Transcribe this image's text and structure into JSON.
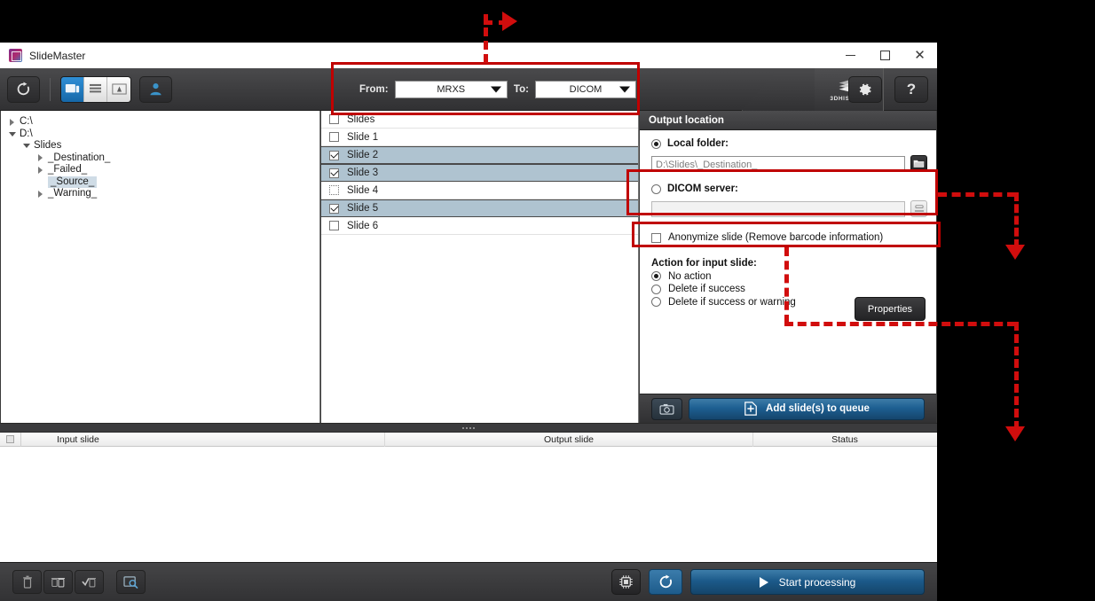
{
  "window": {
    "title": "SlideMaster",
    "logo_icon": "slidemaster-logo-icon",
    "minimize_label": "–",
    "maximize_label": "□",
    "close_label": "✕"
  },
  "toolbar": {
    "refresh_icon": "refresh-icon",
    "view_modes": [
      {
        "icon": "local-view-icon",
        "active": true
      },
      {
        "icon": "list-view-icon",
        "active": false
      },
      {
        "icon": "scanner-view-icon",
        "active": false
      }
    ],
    "user_icon": "user-icon",
    "from_label": "From:",
    "from_value": "MRXS",
    "to_label": "To:",
    "to_value": "DICOM",
    "brand_name": "3DHISTECH",
    "brand_icon": "stacked-slides-icon",
    "settings_icon": "gear-icon",
    "help_label": "?"
  },
  "tree": {
    "nodes": [
      {
        "label": "C:\\",
        "depth": 0,
        "expander": "collapsed",
        "selected": false
      },
      {
        "label": "D:\\",
        "depth": 0,
        "expander": "expanded",
        "selected": false
      },
      {
        "label": "Slides",
        "depth": 1,
        "expander": "expanded",
        "selected": false
      },
      {
        "label": "_Destination_",
        "depth": 2,
        "expander": "collapsed",
        "selected": false
      },
      {
        "label": "_Failed_",
        "depth": 2,
        "expander": "collapsed",
        "selected": false
      },
      {
        "label": "_Source_",
        "depth": 2,
        "expander": "none",
        "selected": true
      },
      {
        "label": "_Warning_",
        "depth": 2,
        "expander": "collapsed",
        "selected": false
      }
    ]
  },
  "slide_list": {
    "rows": [
      {
        "label": "Slides",
        "checked": false,
        "selected": false,
        "dotted": false
      },
      {
        "label": "Slide 1",
        "checked": false,
        "selected": false,
        "dotted": false
      },
      {
        "label": "Slide 2",
        "checked": true,
        "selected": true,
        "dotted": false
      },
      {
        "label": "Slide 3",
        "checked": true,
        "selected": true,
        "dotted": false
      },
      {
        "label": "Slide 4",
        "checked": false,
        "selected": false,
        "dotted": true
      },
      {
        "label": "Slide 5",
        "checked": true,
        "selected": true,
        "dotted": false
      },
      {
        "label": "Slide 6",
        "checked": false,
        "selected": false,
        "dotted": false
      }
    ]
  },
  "output_panel": {
    "header": "Output location",
    "local_folder_label": "Local folder:",
    "local_folder_selected": true,
    "local_folder_value": "D:\\Slides\\_Destination_",
    "browse_icon": "folder-icon",
    "dicom_server_label": "DICOM server:",
    "dicom_server_selected": false,
    "dicom_server_value": "",
    "dicom_browse_icon": "server-icon",
    "anonymize_label": "Anonymize slide (Remove barcode information)",
    "anonymize_checked": false,
    "action_title": "Action for input slide:",
    "actions": [
      {
        "label": "No action",
        "selected": true
      },
      {
        "label": "Delete if success",
        "selected": false
      },
      {
        "label": "Delete if success or warning",
        "selected": false
      }
    ],
    "properties_label": "Properties",
    "camera_icon": "camera-icon",
    "add_queue_label": "Add slide(s) to queue",
    "add_queue_icon": "add-file-icon"
  },
  "queue": {
    "select_all_icon": "select-all-checkbox",
    "columns": [
      "Input slide",
      "Output slide",
      "Status"
    ],
    "rows": []
  },
  "bottom_bar": {
    "buttons": [
      {
        "icon": "delete-icon"
      },
      {
        "icon": "delete-all-icon"
      },
      {
        "icon": "delete-completed-icon"
      },
      {
        "icon": "preview-slide-icon"
      }
    ],
    "cpu_icon": "cpu-icon",
    "refresh_icon": "refresh-icon",
    "start_label": "Start processing",
    "start_icon": "play-icon"
  },
  "annotations": {
    "highlight_color": "#c00000",
    "arrow_color": "#d10d0d"
  }
}
